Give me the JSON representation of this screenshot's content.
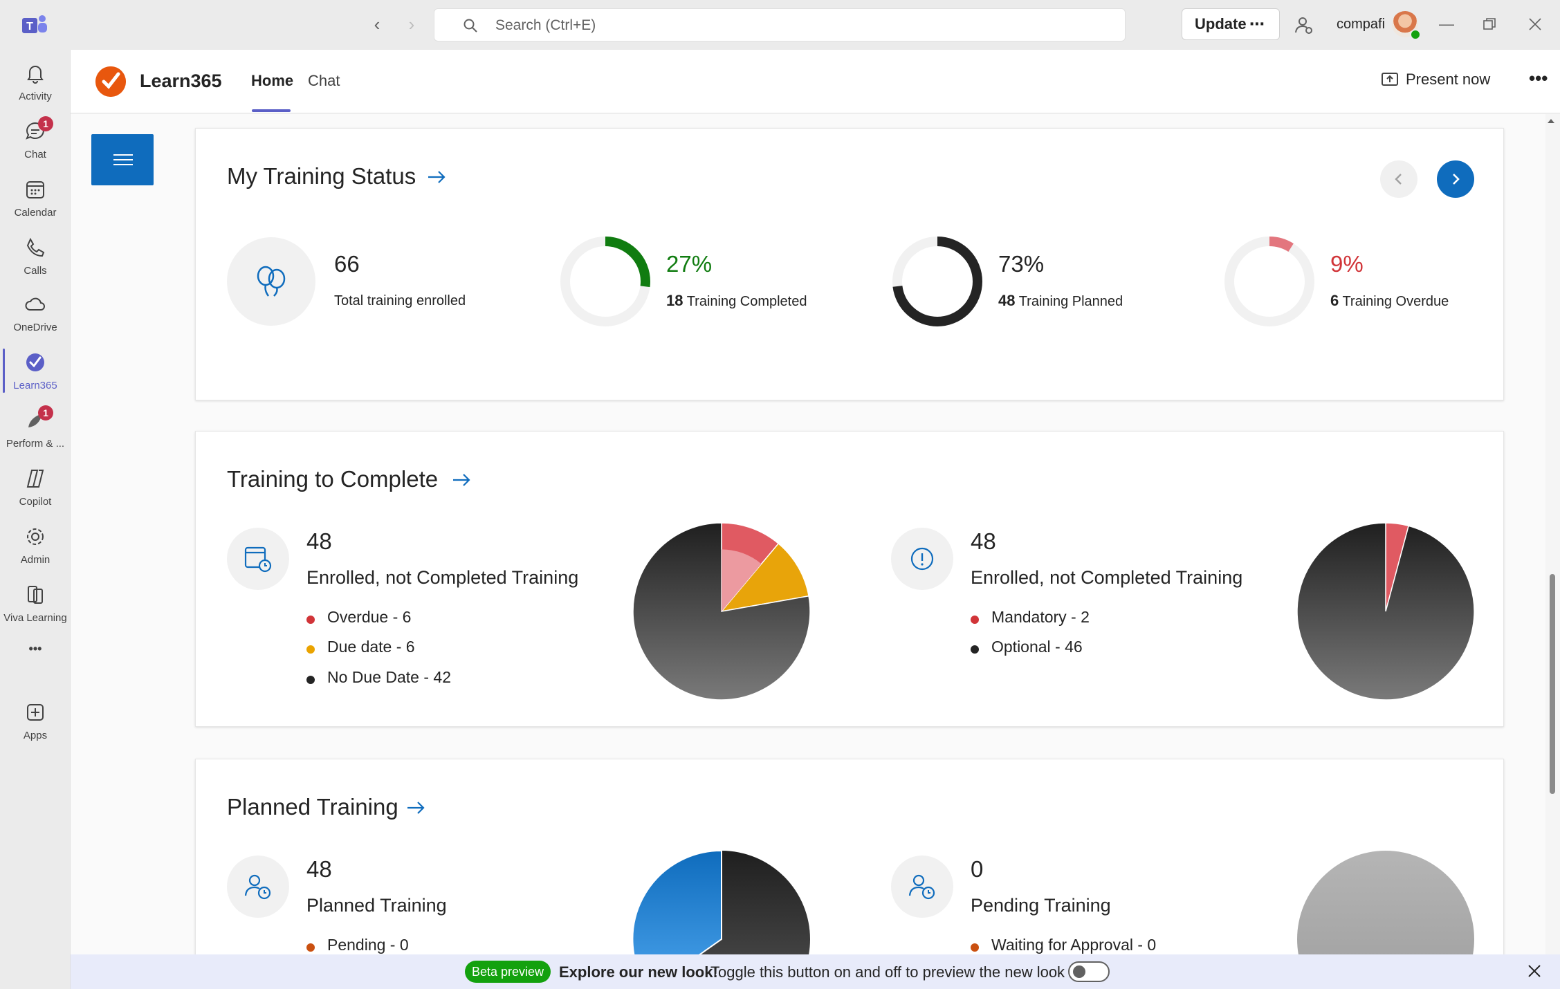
{
  "titlebar": {
    "search_placeholder": "Search (Ctrl+E)",
    "update_label": "Update",
    "update_more": "⋯",
    "user_name": "compafi"
  },
  "rail": {
    "items": [
      {
        "label": "Activity",
        "icon": "bell-icon"
      },
      {
        "label": "Chat",
        "icon": "chat-icon",
        "badge": "1"
      },
      {
        "label": "Calendar",
        "icon": "calendar-icon"
      },
      {
        "label": "Calls",
        "icon": "phone-icon"
      },
      {
        "label": "OneDrive",
        "icon": "cloud-icon"
      },
      {
        "label": "Learn365",
        "icon": "learn365-icon"
      },
      {
        "label": "Perform & ...",
        "icon": "perform-icon",
        "badge": "1"
      },
      {
        "label": "Copilot",
        "icon": "copilot-icon"
      },
      {
        "label": "Admin",
        "icon": "admin-icon"
      },
      {
        "label": "Viva Learning",
        "icon": "viva-learning-icon"
      },
      {
        "label": "•••",
        "icon": "more-icon"
      },
      {
        "label": "Apps",
        "icon": "apps-icon"
      }
    ]
  },
  "app": {
    "name": "Learn365",
    "tabs": [
      {
        "label": "Home"
      },
      {
        "label": "Chat"
      }
    ],
    "present_label": "Present now",
    "more_label": "•••"
  },
  "training_status": {
    "title": "My Training Status",
    "enrolled": {
      "value": "66",
      "label": "Total training enrolled"
    },
    "completed": {
      "pct": "27%",
      "count": "18",
      "label": "Training Completed",
      "fraction": 0.27,
      "color": "#107c10"
    },
    "planned": {
      "pct": "73%",
      "count": "48",
      "label": "Training Planned",
      "fraction": 0.73,
      "color": "#242424"
    },
    "overdue": {
      "pct": "9%",
      "count": "6",
      "label": "Training Overdue",
      "fraction": 0.09,
      "color": "#d13438"
    }
  },
  "training_to_complete": {
    "title": "Training to Complete",
    "left": {
      "value": "48",
      "desc": "Enrolled, not Completed Training",
      "legend": [
        {
          "label": "Overdue - 6",
          "color": "#d13438",
          "value": 6
        },
        {
          "label": "Due date - 6",
          "color": "#eaa300",
          "value": 6
        },
        {
          "label": "No Due Date - 42",
          "color": "#242424",
          "value": 42
        }
      ]
    },
    "right": {
      "value": "48",
      "desc": "Enrolled, not Completed Training",
      "legend": [
        {
          "label": "Mandatory - 2",
          "color": "#d13438",
          "value": 2
        },
        {
          "label": "Optional - 46",
          "color": "#242424",
          "value": 46
        }
      ]
    }
  },
  "planned_training": {
    "title": "Planned Training",
    "left": {
      "value": "48",
      "desc": "Planned Training",
      "legend": [
        {
          "label": "Pending - 0",
          "color": "#ca5010"
        }
      ]
    },
    "right": {
      "value": "0",
      "desc": "Pending Training",
      "legend": [
        {
          "label": "Waiting for Approval - 0",
          "color": "#ca5010"
        }
      ]
    }
  },
  "banner": {
    "beta_label": "Beta preview",
    "headline": "Explore our new look!",
    "text": "Toggle this button on and off to preview the new look"
  }
}
